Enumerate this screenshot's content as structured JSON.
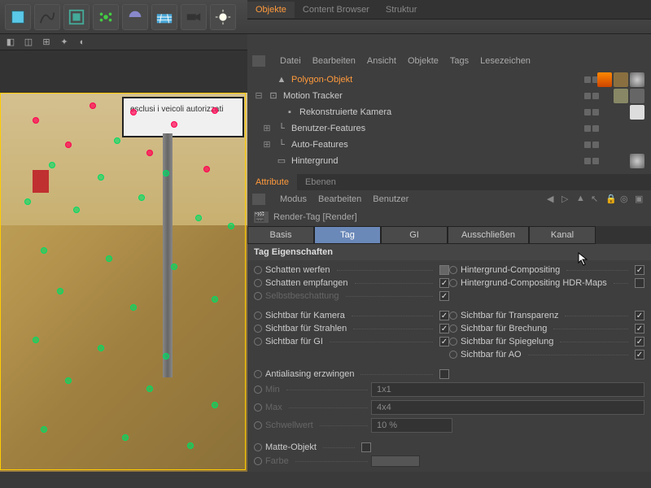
{
  "toolbar_icons": [
    "cube",
    "spline",
    "array",
    "cloner",
    "boole",
    "floor",
    "camera",
    "light"
  ],
  "tabs_top": {
    "objekte": "Objekte",
    "content": "Content Browser",
    "struktur": "Struktur"
  },
  "menu_top": [
    "Datei",
    "Bearbeiten",
    "Ansicht",
    "Objekte",
    "Tags",
    "Lesezeichen"
  ],
  "hierarchy": [
    {
      "label": "Polygon-Objekt",
      "active": true,
      "indent": 1,
      "expand": "",
      "icon": "poly"
    },
    {
      "label": "Motion Tracker",
      "indent": 1,
      "expand": "⊟",
      "icon": "tracker"
    },
    {
      "label": "Rekonstruierte Kamera",
      "indent": 2,
      "expand": "",
      "icon": "cam"
    },
    {
      "label": "Benutzer-Features",
      "indent": 2,
      "expand": "⊞",
      "icon": "feat"
    },
    {
      "label": "Auto-Features",
      "indent": 2,
      "expand": "⊞",
      "icon": "feat"
    },
    {
      "label": "Hintergrund",
      "indent": 1,
      "expand": "",
      "icon": "bg"
    }
  ],
  "tabs_attr": {
    "attribute": "Attribute",
    "ebenen": "Ebenen"
  },
  "menu_attr": [
    "Modus",
    "Bearbeiten",
    "Benutzer"
  ],
  "attr_header": "Render-Tag [Render]",
  "attr_tabs": [
    "Basis",
    "Tag",
    "GI",
    "Ausschließen",
    "Kanal"
  ],
  "attr_tab_active": 1,
  "section_title": "Tag Eigenschaften",
  "props": {
    "r1l": "Schatten werfen",
    "r1r": "Hintergrund-Compositing",
    "r2l": "Schatten empfangen",
    "r2r": "Hintergrund-Compositing HDR-Maps",
    "r3l": "Selbstbeschattung",
    "r4l": "Sichtbar für Kamera",
    "r4r": "Sichtbar für Transparenz",
    "r5l": "Sichtbar für Strahlen",
    "r5r": "Sichtbar für Brechung",
    "r6l": "Sichtbar für GI",
    "r6r": "Sichtbar für Spiegelung",
    "r7r": "Sichtbar für AO",
    "aa": "Antialiasing erzwingen",
    "min": "Min",
    "min_v": "1x1",
    "max": "Max",
    "max_v": "4x4",
    "schwell": "Schwellwert",
    "schwell_v": "10 %",
    "matte": "Matte-Objekt",
    "farbe": "Farbe"
  },
  "sign_text": "esclusi i veicoli autorizzati"
}
